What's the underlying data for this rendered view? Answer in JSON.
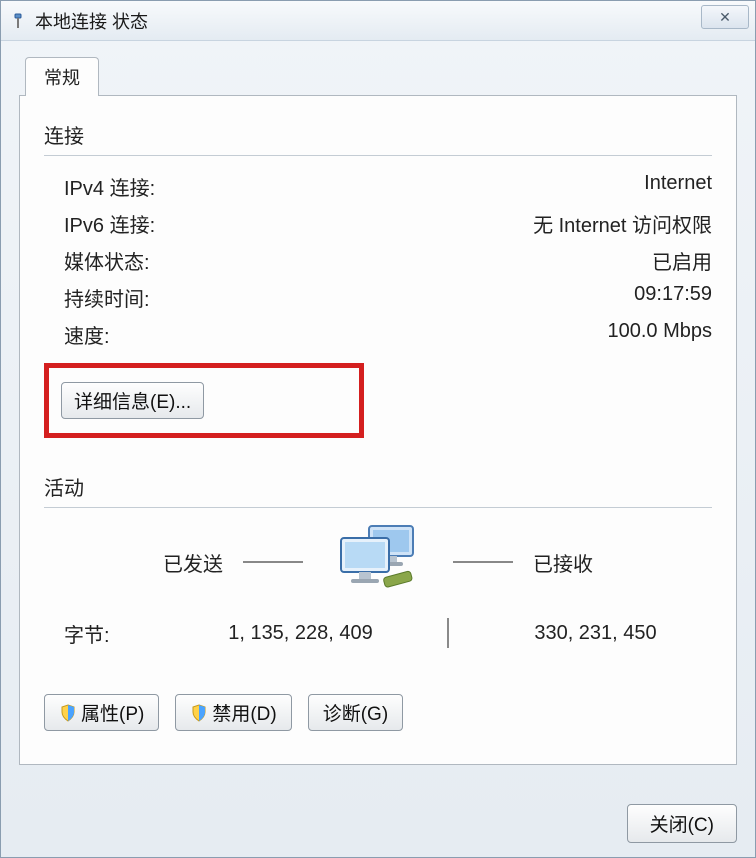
{
  "window": {
    "title": "本地连接 状态",
    "close_glyph": "✕"
  },
  "tab": {
    "general": "常规"
  },
  "connection": {
    "group_label": "连接",
    "rows": {
      "ipv4_label": "IPv4 连接:",
      "ipv4_value": "Internet",
      "ipv6_label": "IPv6 连接:",
      "ipv6_value": "无 Internet 访问权限",
      "media_label": "媒体状态:",
      "media_value": "已启用",
      "duration_label": "持续时间:",
      "duration_value": "09:17:59",
      "speed_label": "速度:",
      "speed_value": "100.0 Mbps"
    },
    "details_button": "详细信息(E)..."
  },
  "activity": {
    "group_label": "活动",
    "sent_label": "已发送",
    "received_label": "已接收",
    "bytes_label": "字节:",
    "bytes_sent": "1, 135, 228, 409",
    "bytes_received": "330, 231, 450"
  },
  "buttons": {
    "properties": "属性(P)",
    "disable": "禁用(D)",
    "diagnose": "诊断(G)",
    "close": "关闭(C)"
  }
}
